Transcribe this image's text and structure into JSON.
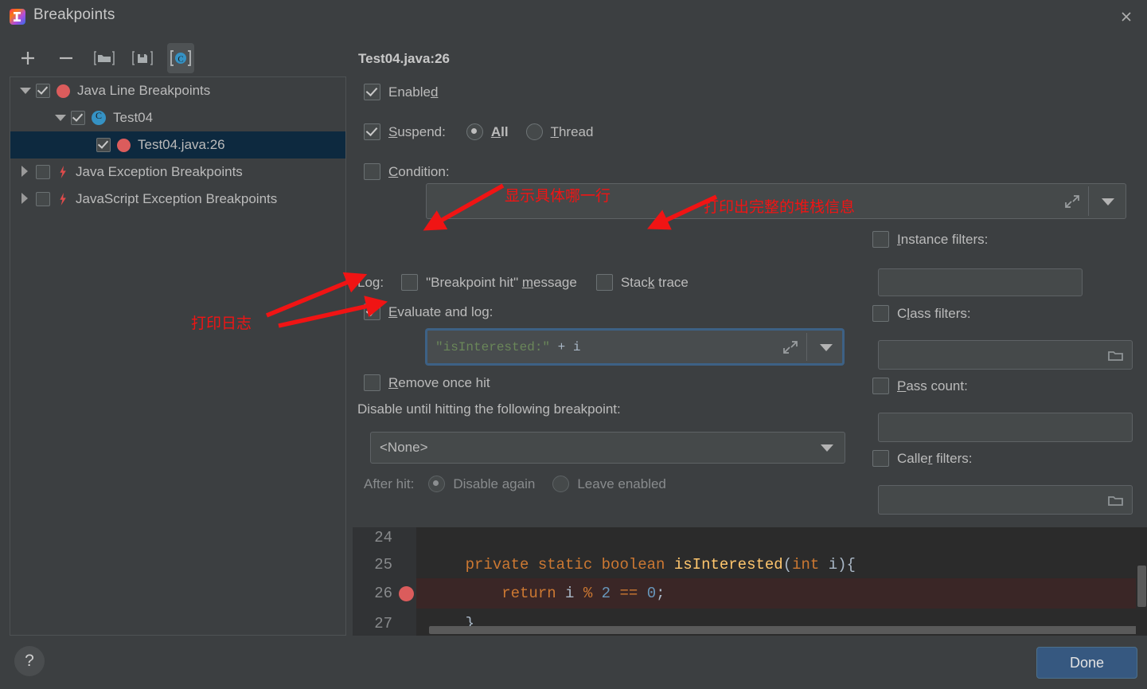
{
  "window": {
    "title": "Breakpoints",
    "logo_icon": "intellij-idea-logo",
    "close_icon": "close-icon"
  },
  "toolbar": {
    "buttons": [
      {
        "name": "add-breakpoint",
        "icon": "plus-icon",
        "active": false
      },
      {
        "name": "remove-breakpoint",
        "icon": "minus-icon",
        "active": false
      },
      {
        "name": "import-breakpoints",
        "icon": "folder-open-icon",
        "active": false
      },
      {
        "name": "export-breakpoints",
        "icon": "save-floppy-icon",
        "active": false
      },
      {
        "name": "group-by-class",
        "icon": "class-c-icon",
        "active": true
      }
    ]
  },
  "tree": {
    "rows": [
      {
        "label": "Java Line Breakpoints",
        "indent": 0,
        "twisty": "down",
        "checked": true,
        "icon": "breakpoint-dot-icon",
        "selected": false
      },
      {
        "label": "Test04",
        "indent": 1,
        "twisty": "down",
        "checked": true,
        "icon": "class-icon",
        "selected": false
      },
      {
        "label": "Test04.java:26",
        "indent": 2,
        "twisty": "none",
        "checked": true,
        "icon": "breakpoint-dot-icon",
        "selected": true
      },
      {
        "label": "Java Exception Breakpoints",
        "indent": 0,
        "twisty": "right",
        "checked": false,
        "icon": "exception-bolt-icon",
        "selected": false
      },
      {
        "label": "JavaScript Exception Breakpoints",
        "indent": 0,
        "twisty": "right",
        "checked": false,
        "icon": "exception-bolt-icon",
        "selected": false
      }
    ]
  },
  "detail": {
    "title": "Test04.java:26",
    "enabled": {
      "label": "Enabled",
      "checked": true
    },
    "suspend": {
      "label": "Suspend:",
      "checked": true,
      "options": [
        "All",
        "Thread"
      ],
      "selected": "All"
    },
    "condition": {
      "label": "Condition:",
      "checked": false,
      "value": "",
      "expand_icon": "expand-icon",
      "dropdown_icon": "chevron-down-icon"
    },
    "log": {
      "label": "Log:",
      "message": {
        "label": "\"Breakpoint hit\" message",
        "checked": false
      },
      "stack_trace": {
        "label": "Stack trace",
        "checked": false
      }
    },
    "evaluate_and_log": {
      "label": "Evaluate and log:",
      "checked": true,
      "expression_string": "\"isInterested:\"",
      "expression_operator": "+",
      "expression_identifier": "i",
      "expand_icon": "expand-icon",
      "dropdown_icon": "chevron-down-icon"
    },
    "remove_once_hit": {
      "label": "Remove once hit",
      "checked": false
    },
    "disable_until": {
      "label": "Disable until hitting the following breakpoint:",
      "value": "<None>",
      "dropdown_icon": "chevron-down-icon"
    },
    "after_hit": {
      "label": "After hit:",
      "options": [
        "Disable again",
        "Leave enabled"
      ],
      "selected": "Disable again",
      "disabled": true
    },
    "filters": {
      "instance": {
        "label": "Instance filters:",
        "checked": false,
        "value": "",
        "button_label": "...",
        "button_icon": "ellipsis-icon"
      },
      "class": {
        "label": "Class filters:",
        "checked": false,
        "value": "",
        "icon": "folder-icon"
      },
      "pass_count": {
        "label": "Pass count:",
        "checked": false,
        "value": ""
      },
      "caller": {
        "label": "Caller filters:",
        "checked": false,
        "value": "",
        "icon": "folder-icon"
      }
    }
  },
  "code_preview": {
    "lines": [
      {
        "number": "24",
        "highlight": false,
        "has_breakpoint": false,
        "tokens": []
      },
      {
        "number": "25",
        "highlight": false,
        "has_breakpoint": false,
        "tokens": [
          {
            "t": "    ",
            "c": "pl"
          },
          {
            "t": "private ",
            "c": "kw"
          },
          {
            "t": "static ",
            "c": "kw"
          },
          {
            "t": "boolean ",
            "c": "kw"
          },
          {
            "t": "isInterested",
            "c": "fn"
          },
          {
            "t": "(",
            "c": "pl"
          },
          {
            "t": "int ",
            "c": "kw"
          },
          {
            "t": "i){",
            "c": "pl"
          }
        ]
      },
      {
        "number": "26",
        "highlight": true,
        "has_breakpoint": true,
        "tokens": [
          {
            "t": "        ",
            "c": "pl"
          },
          {
            "t": "return ",
            "c": "kw"
          },
          {
            "t": "i ",
            "c": "pl"
          },
          {
            "t": "% ",
            "c": "kw"
          },
          {
            "t": "2 ",
            "c": "nm"
          },
          {
            "t": "== ",
            "c": "kw"
          },
          {
            "t": "0",
            "c": "nm"
          },
          {
            "t": ";",
            "c": "pl"
          }
        ]
      },
      {
        "number": "27",
        "highlight": false,
        "has_breakpoint": false,
        "tokens": [
          {
            "t": "    }",
            "c": "pl"
          }
        ]
      }
    ]
  },
  "bottom": {
    "help_label": "?",
    "help_icon": "help-question-icon",
    "done_label": "Done"
  },
  "annotations": [
    {
      "text": "显示具体哪一行",
      "name": "annotation-show-line"
    },
    {
      "text": "打印出完整的堆栈信息",
      "name": "annotation-print-stack"
    },
    {
      "text": "打印日志",
      "name": "annotation-print-log"
    }
  ],
  "colors": {
    "accent_blue": "#365880",
    "selection_blue": "#0d293f",
    "breakpoint_red": "#db5c5c",
    "annotation_red": "#f01414",
    "panel_bg": "#3c3f41",
    "code_bg": "#2b2b2b"
  }
}
